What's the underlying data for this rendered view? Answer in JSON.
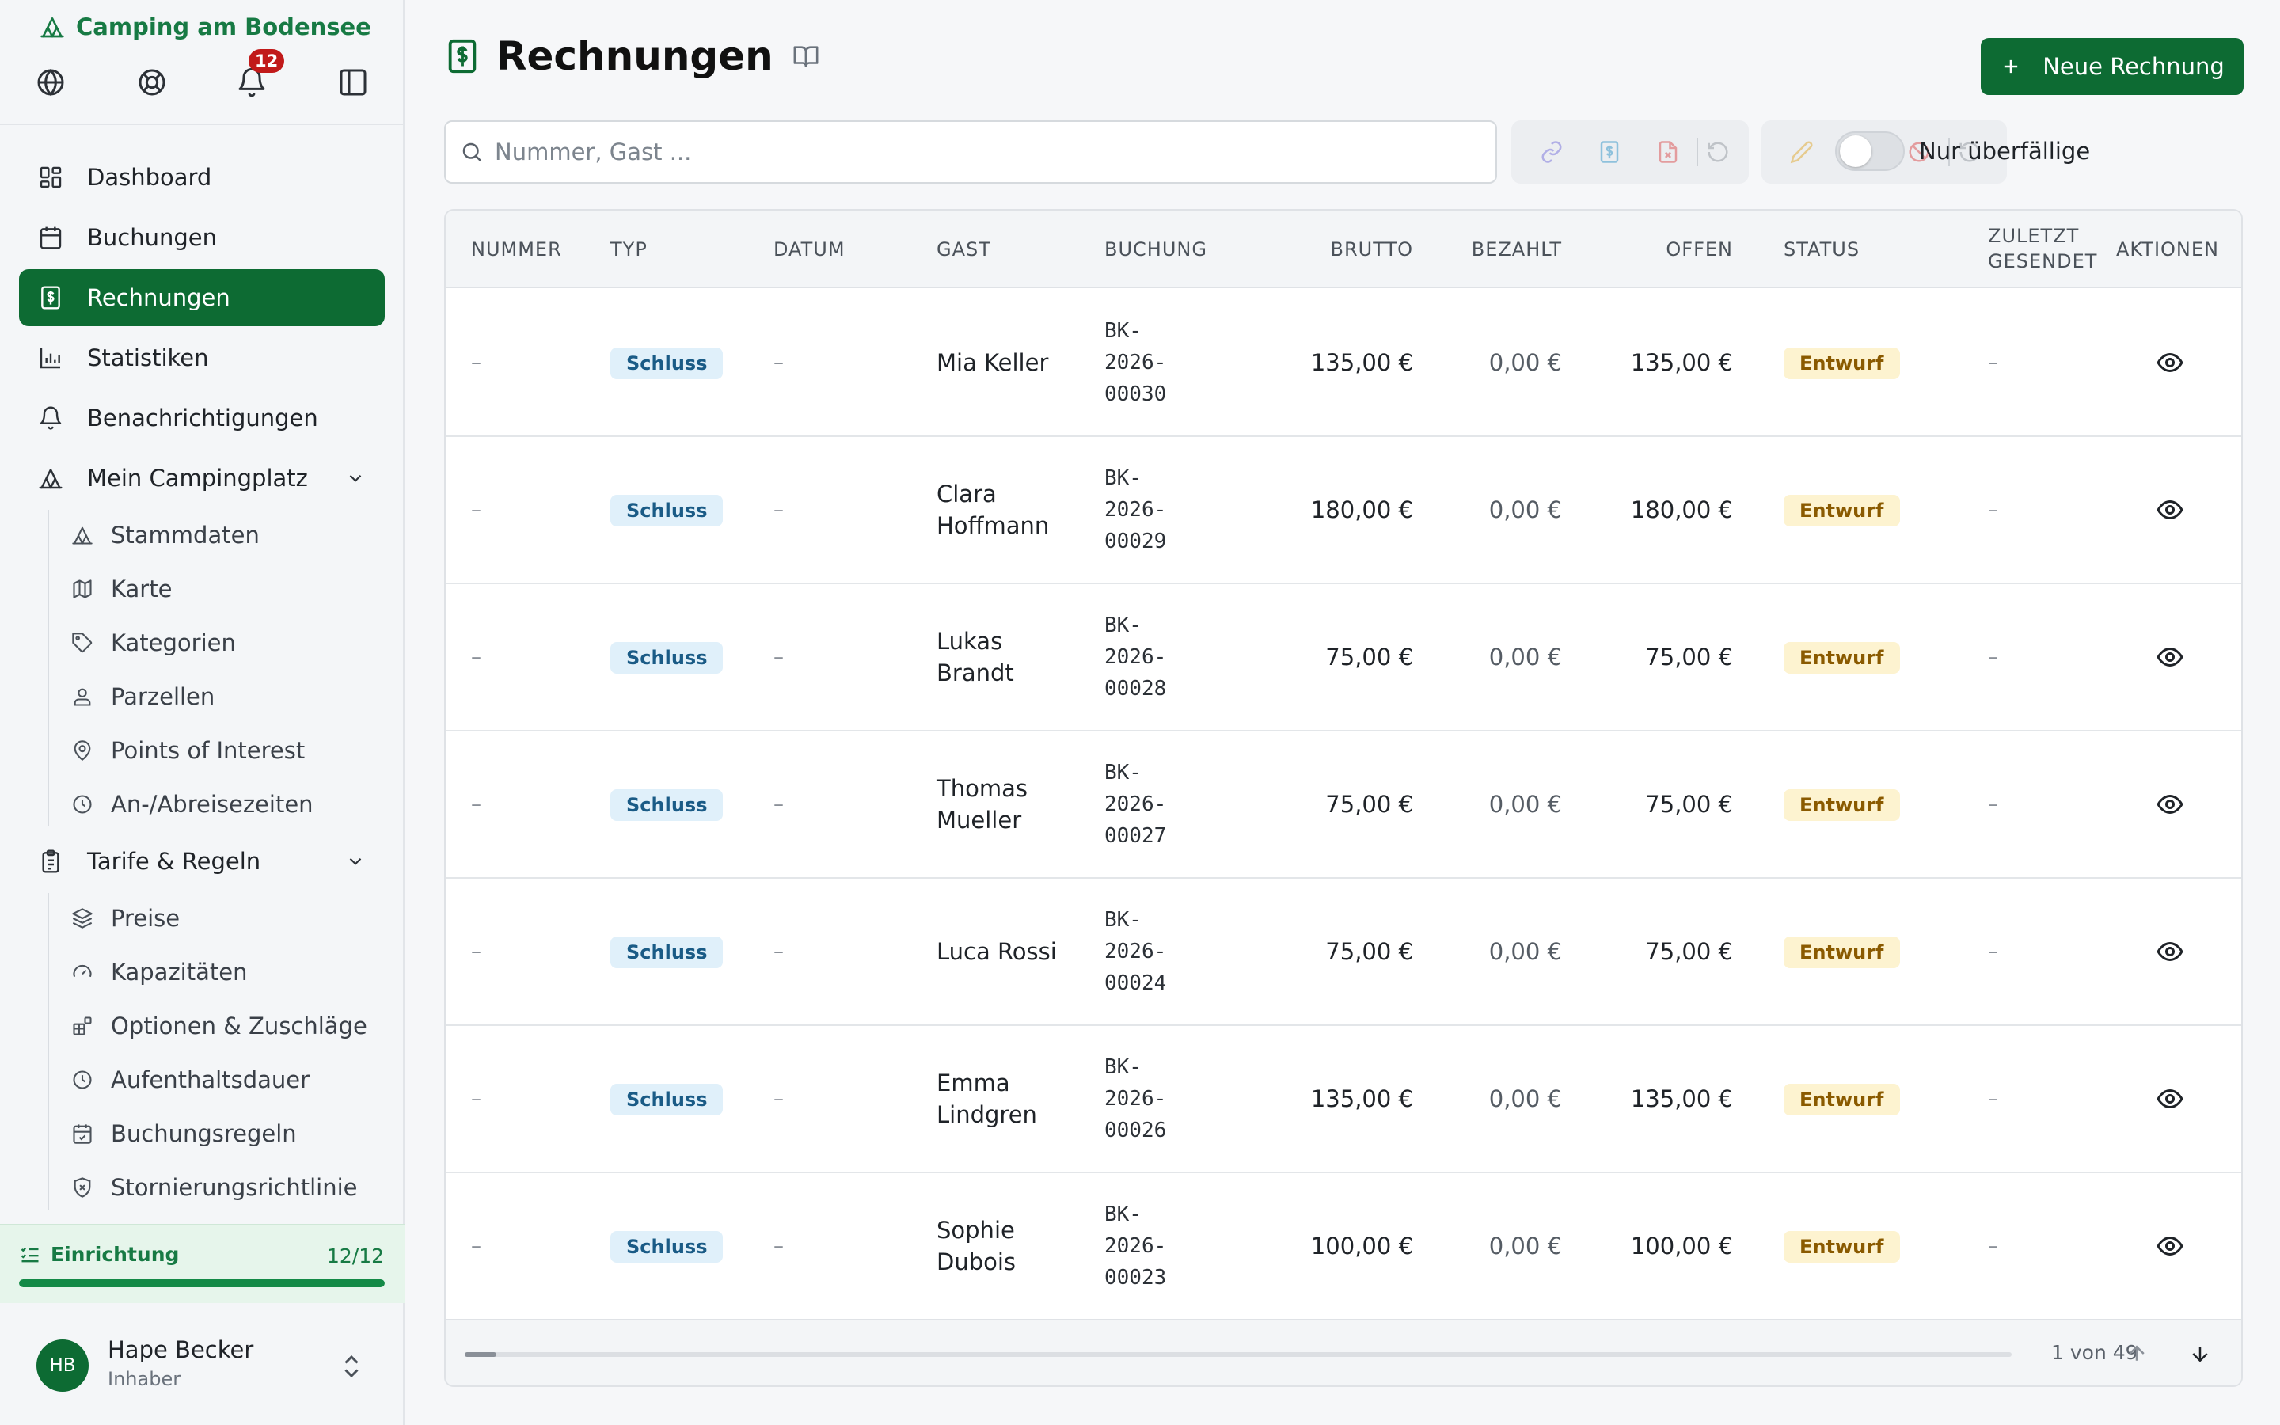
{
  "brand": {
    "name": "Camping am Bodensee"
  },
  "notifications": {
    "count": "12"
  },
  "nav": {
    "dashboard": "Dashboard",
    "buchungen": "Buchungen",
    "rechnungen": "Rechnungen",
    "statistiken": "Statistiken",
    "benachrichtigungen": "Benachrichtigungen",
    "mein_campingplatz": "Mein Campingplatz",
    "tarife": "Tarife & Regeln"
  },
  "sub_campingplatz": [
    "Stammdaten",
    "Karte",
    "Kategorien",
    "Parzellen",
    "Points of Interest",
    "An-/Abreisezeiten"
  ],
  "sub_tarife": [
    "Preise",
    "Kapazitäten",
    "Optionen & Zuschläge",
    "Aufenthaltsdauer",
    "Buchungsregeln",
    "Stornierungsrichtlinie"
  ],
  "setup": {
    "label": "Einrichtung",
    "count": "12/12",
    "progress": 1.0
  },
  "user": {
    "initials": "HB",
    "name": "Hape Becker",
    "role": "Inhaber"
  },
  "page": {
    "title": "Rechnungen",
    "new_button": "Neue Rechnung"
  },
  "search": {
    "placeholder": "Nummer, Gast ..."
  },
  "filter": {
    "overdue_label": "Nur überfällige",
    "overdue_on": false
  },
  "table": {
    "headers": {
      "nummer": "NUMMER",
      "typ": "TYP",
      "datum": "DATUM",
      "gast": "GAST",
      "buchung": "BUCHUNG",
      "brutto": "BRUTTO",
      "bezahlt": "BEZAHLT",
      "offen": "OFFEN",
      "status": "STATUS",
      "zuletzt_1": "ZULETZT",
      "zuletzt_2": "GESENDET",
      "aktionen": "AKTIONEN"
    },
    "rows": [
      {
        "nummer": "–",
        "typ": "Schluss",
        "datum": "–",
        "gast_1": "Mia Keller",
        "gast_2": "",
        "buchung_1": "BK-",
        "buchung_2": "2026-",
        "buchung_3": "00030",
        "brutto": "135,00 €",
        "bezahlt": "0,00 €",
        "offen": "135,00 €",
        "status": "Entwurf",
        "gesendet": "–"
      },
      {
        "nummer": "–",
        "typ": "Schluss",
        "datum": "–",
        "gast_1": "Clara",
        "gast_2": "Hoffmann",
        "buchung_1": "BK-",
        "buchung_2": "2026-",
        "buchung_3": "00029",
        "brutto": "180,00 €",
        "bezahlt": "0,00 €",
        "offen": "180,00 €",
        "status": "Entwurf",
        "gesendet": "–"
      },
      {
        "nummer": "–",
        "typ": "Schluss",
        "datum": "–",
        "gast_1": "Lukas",
        "gast_2": "Brandt",
        "buchung_1": "BK-",
        "buchung_2": "2026-",
        "buchung_3": "00028",
        "brutto": "75,00 €",
        "bezahlt": "0,00 €",
        "offen": "75,00 €",
        "status": "Entwurf",
        "gesendet": "–"
      },
      {
        "nummer": "–",
        "typ": "Schluss",
        "datum": "–",
        "gast_1": "Thomas",
        "gast_2": "Mueller",
        "buchung_1": "BK-",
        "buchung_2": "2026-",
        "buchung_3": "00027",
        "brutto": "75,00 €",
        "bezahlt": "0,00 €",
        "offen": "75,00 €",
        "status": "Entwurf",
        "gesendet": "–"
      },
      {
        "nummer": "–",
        "typ": "Schluss",
        "datum": "–",
        "gast_1": "Luca Rossi",
        "gast_2": "",
        "buchung_1": "BK-",
        "buchung_2": "2026-",
        "buchung_3": "00024",
        "brutto": "75,00 €",
        "bezahlt": "0,00 €",
        "offen": "75,00 €",
        "status": "Entwurf",
        "gesendet": "–"
      },
      {
        "nummer": "–",
        "typ": "Schluss",
        "datum": "–",
        "gast_1": "Emma",
        "gast_2": "Lindgren",
        "buchung_1": "BK-",
        "buchung_2": "2026-",
        "buchung_3": "00026",
        "brutto": "135,00 €",
        "bezahlt": "0,00 €",
        "offen": "135,00 €",
        "status": "Entwurf",
        "gesendet": "–"
      },
      {
        "nummer": "–",
        "typ": "Schluss",
        "datum": "–",
        "gast_1": "Sophie",
        "gast_2": "Dubois",
        "buchung_1": "BK-",
        "buchung_2": "2026-",
        "buchung_3": "00023",
        "brutto": "100,00 €",
        "bezahlt": "0,00 €",
        "offen": "100,00 €",
        "status": "Entwurf",
        "gesendet": "–"
      }
    ],
    "pagination": "1 von 49"
  },
  "colors": {
    "brand": "#0d6b33",
    "brand_text": "#177a44",
    "badge_type_bg": "#e0f0fa",
    "badge_status_bg": "#fdf3d0",
    "notification": "#c11a1a"
  }
}
